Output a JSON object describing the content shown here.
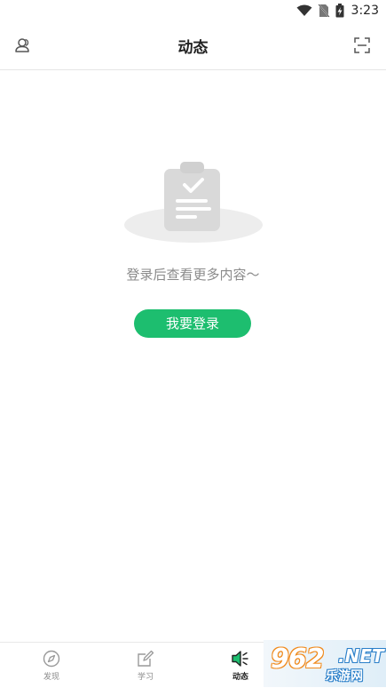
{
  "status_bar": {
    "time": "3:23"
  },
  "header": {
    "title": "动态"
  },
  "empty_state": {
    "message": "登录后查看更多内容～",
    "login_label": "我要登录"
  },
  "tabbar": {
    "items": [
      {
        "label": "发现",
        "icon": "compass-icon"
      },
      {
        "label": "学习",
        "icon": "edit-icon"
      },
      {
        "label": "动态",
        "icon": "speaker-icon"
      }
    ]
  },
  "watermark": {
    "number": "962",
    "suffix": ".NET",
    "name": "乐游网"
  },
  "colors": {
    "accent": "#1dbe6f",
    "text_muted": "#8a8a8a"
  }
}
